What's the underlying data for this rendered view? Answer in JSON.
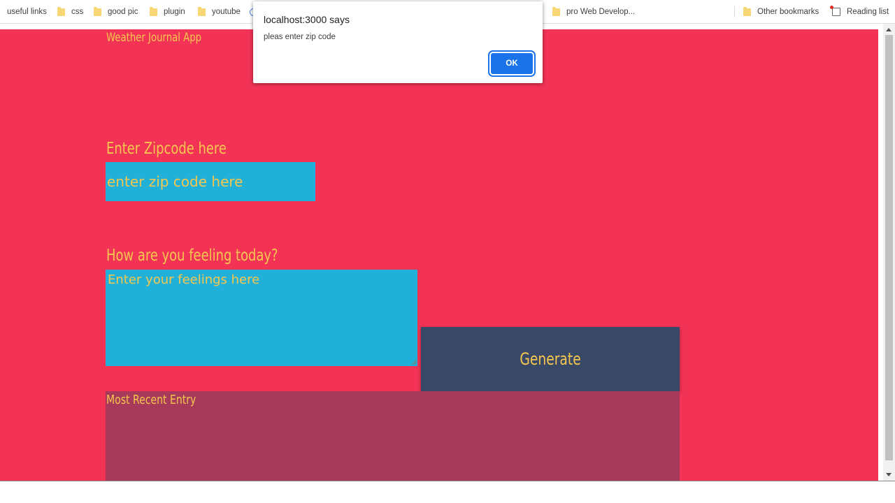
{
  "bookmarks_bar": {
    "items": [
      {
        "label": "useful links",
        "icon": "folder-icon"
      },
      {
        "label": "css",
        "icon": "folder-icon"
      },
      {
        "label": "good pic",
        "icon": "folder-icon"
      },
      {
        "label": "plugin",
        "icon": "folder-icon"
      },
      {
        "label": "youtube",
        "icon": "folder-icon"
      },
      {
        "label": "",
        "icon": "globe-icon"
      },
      {
        "label": "pro Web Develop...",
        "icon": "folder-icon"
      }
    ],
    "other_bookmarks": "Other bookmarks",
    "reading_list": "Reading list"
  },
  "page": {
    "title": "Weather Journal App",
    "zip_label": "Enter Zipcode here",
    "zip_placeholder": "enter zip code here",
    "feelings_label": "How are you feeling today?",
    "feelings_placeholder": "Enter your feelings here",
    "generate_label": "Generate",
    "entry_title": "Most Recent Entry"
  },
  "alert": {
    "title": "localhost:3000 says",
    "message": "pleas enter zip code",
    "ok_label": "OK"
  },
  "colors": {
    "page_background": "#f23356",
    "accent_text": "#f5c74e",
    "input_background": "#21b0d8",
    "button_background": "#3a4868",
    "entry_background": "#a73a5a",
    "dialog_button": "#1a73e8"
  }
}
